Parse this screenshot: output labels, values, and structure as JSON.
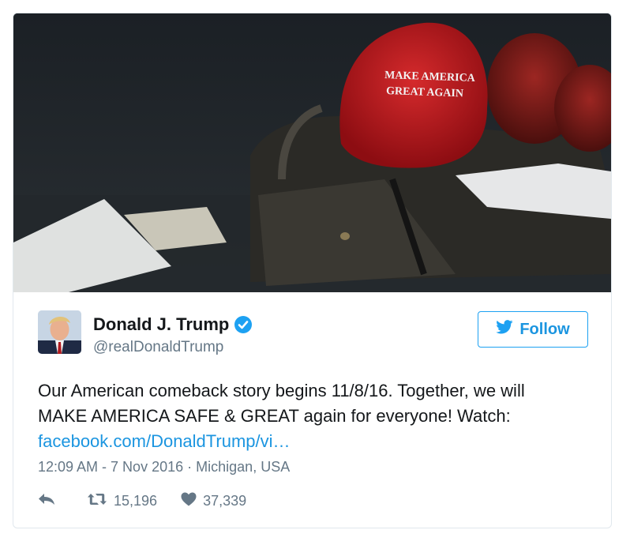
{
  "media": {
    "hat_text_line1": "MAKE AMERICA",
    "hat_text_line2": "GREAT AGAIN"
  },
  "author": {
    "display_name": "Donald J. Trump",
    "handle": "@realDonaldTrump",
    "verified": true
  },
  "follow_button": {
    "label": "Follow",
    "icon": "twitter-bird-icon"
  },
  "tweet": {
    "line1": "Our American comeback story begins 11/8/16. Together, we will",
    "line2": "MAKE AMERICA SAFE & GREAT again for everyone! Watch:",
    "link": "facebook.com/DonaldTrump/vi…"
  },
  "meta": {
    "timestamp": "12:09 AM - 7 Nov 2016",
    "separator": "·",
    "location": "Michigan, USA"
  },
  "actions": {
    "reply_icon": "reply-icon",
    "retweet_count": "15,196",
    "like_count": "37,339"
  },
  "colors": {
    "link": "#1b95e0",
    "muted": "#657786",
    "hat_red": "#c0171d",
    "verified_blue": "#1da1f2"
  }
}
